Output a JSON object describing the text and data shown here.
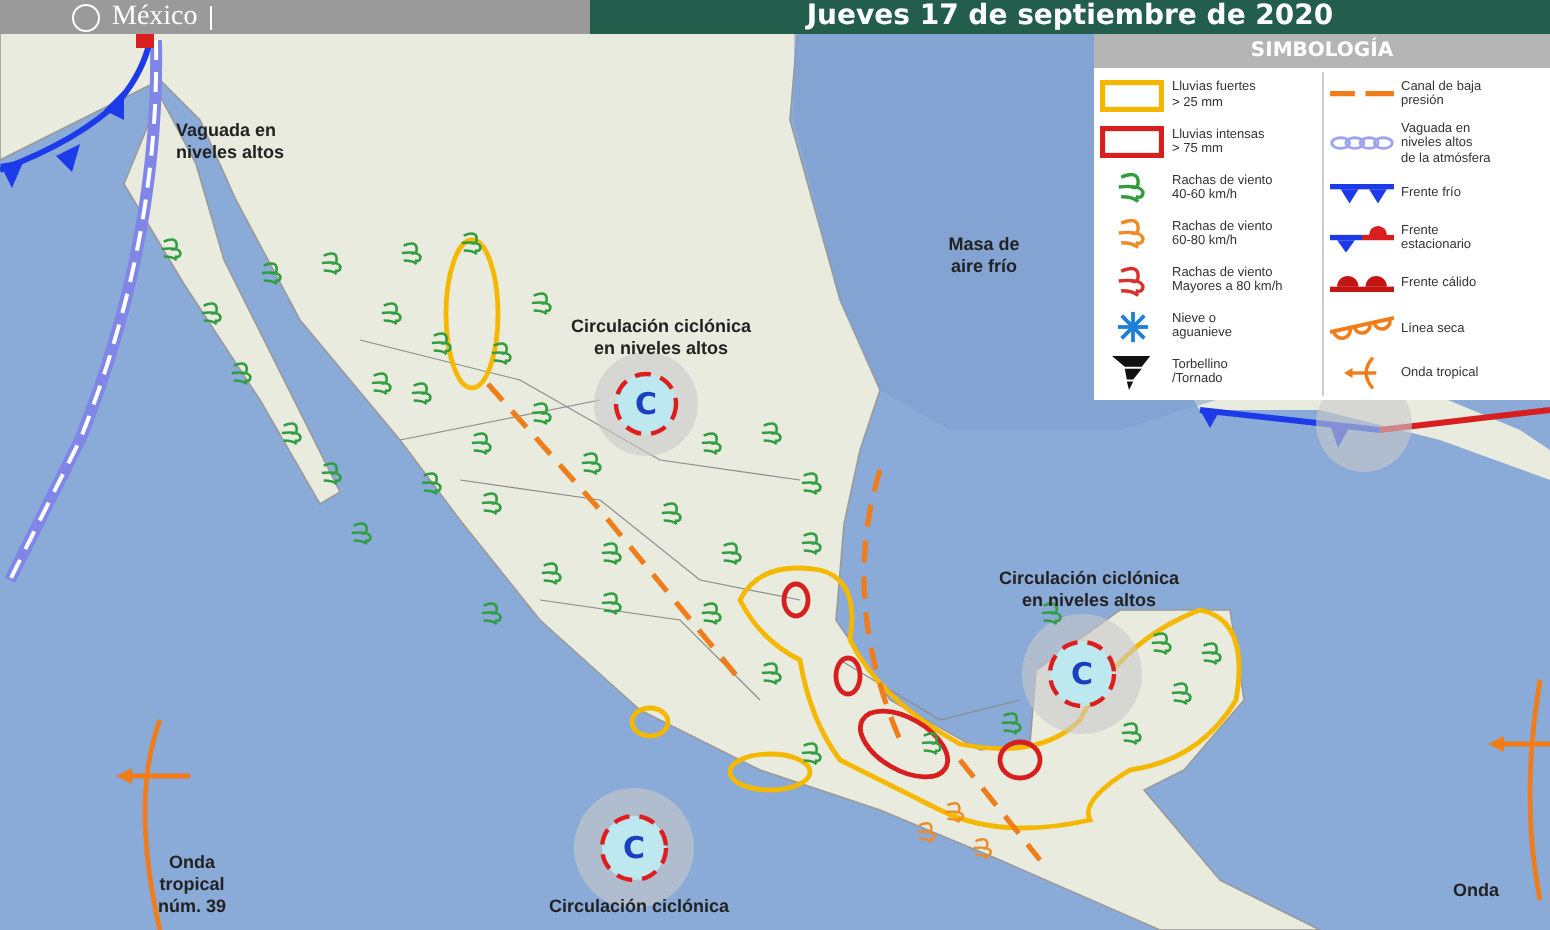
{
  "header": {
    "logo_text": "México",
    "title": "Jueves 17 de septiembre de 2020"
  },
  "map": {
    "labels": [
      {
        "text": "Vaguada en niveles altos"
      },
      {
        "text": "Masa de aire frío"
      },
      {
        "text": "Circulación ciclónica en niveles altos"
      },
      {
        "text": "Circulación ciclónica en niveles altos"
      },
      {
        "text": "Onda tropical núm. 39"
      },
      {
        "text": "Circulación ciclónica"
      },
      {
        "text": "Onda"
      }
    ],
    "cyclones": [
      {
        "text": "C"
      },
      {
        "text": "C"
      },
      {
        "text": "C"
      }
    ]
  },
  "legend": {
    "title": "SIMBOLOGÍA",
    "left": [
      {
        "kind": "rain_box",
        "color": "#f5b800",
        "text": "Lluvias fuertes\n> 25 mm"
      },
      {
        "kind": "rain_box",
        "color": "#d81e1e",
        "text": "Lluvias intensas\n> 75 mm"
      },
      {
        "kind": "wind",
        "color": "#2e9e3e",
        "text": "Rachas de viento\n40-60 km/h"
      },
      {
        "kind": "wind",
        "color": "#f08a24",
        "text": "Rachas de viento\n60-80 km/h"
      },
      {
        "kind": "wind",
        "color": "#d9302c",
        "text": "Rachas de viento\nMayores a 80 km/h"
      },
      {
        "kind": "snow",
        "text": "Nieve o\naguanieve"
      },
      {
        "kind": "tornado",
        "text": "Torbellino\n/Tornado"
      }
    ],
    "right": [
      {
        "kind": "low_trough",
        "text": "Canal de baja\npresión"
      },
      {
        "kind": "upper_trough",
        "text": "Vaguada en\nniveles altos\nde la atmósfera"
      },
      {
        "kind": "cold_front",
        "text": "Frente frío"
      },
      {
        "kind": "stationary_front",
        "text": "Frente\nestacionario"
      },
      {
        "kind": "warm_front",
        "text": "Frente cálido"
      },
      {
        "kind": "dry_line",
        "text": "Línea seca"
      },
      {
        "kind": "tropical_wave",
        "text": "Onda tropical"
      }
    ]
  }
}
